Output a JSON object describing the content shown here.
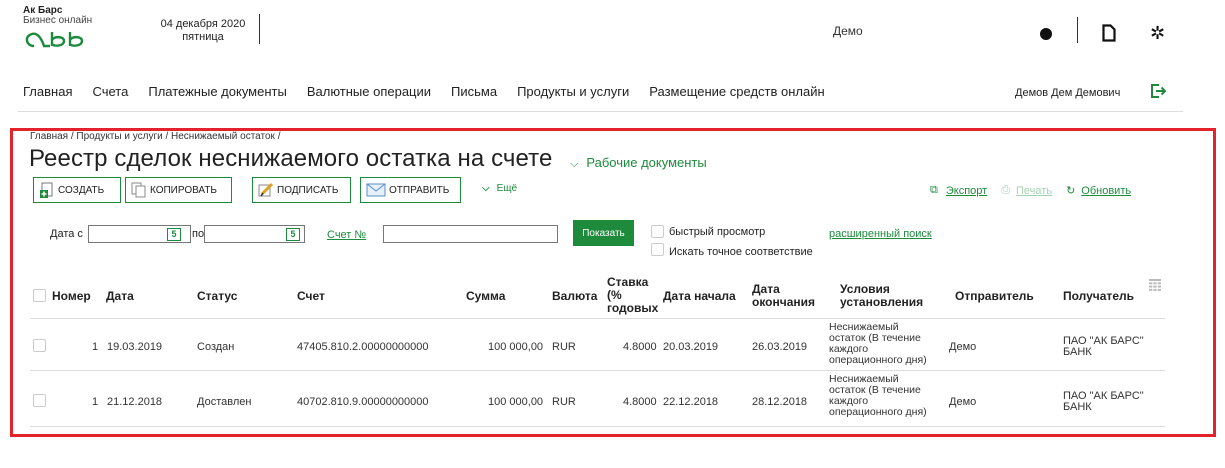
{
  "logo": {
    "line1": "Ак Барс",
    "line2": "Бизнес онлайн"
  },
  "header": {
    "date": "04 декабря 2020",
    "weekday": "пятница",
    "mode": "Демо"
  },
  "nav": {
    "items": [
      "Главная",
      "Счета",
      "Платежные документы",
      "Валютные операции",
      "Письма",
      "Продукты и услуги",
      "Размещение средств онлайн"
    ],
    "user": "Демов Дем Демович"
  },
  "breadcrumb": "Главная  /  Продукты и услуги  /  Неснижаемый остаток  /",
  "page_title": "Реестр сделок неснижаемого остатка на счете",
  "work_docs": "Рабочие документы",
  "toolbar": {
    "create": "СОЗДАТЬ",
    "copy": "КОПИРОВАТЬ",
    "sign": "ПОДПИСАТЬ",
    "send": "ОТПРАВИТЬ",
    "more": "Ещё",
    "export": "Экспорт",
    "print": "Печать",
    "refresh": "Обновить"
  },
  "filters": {
    "date_from_label": "Дата с",
    "date_to_label": "по",
    "account_label": "Счет №",
    "show": "Показать",
    "quick_view": "быстрый просмотр",
    "exact_match": "Искать точное соответствие",
    "advanced": "расширенный поиск"
  },
  "table": {
    "headers": {
      "number": "Номер",
      "date": "Дата",
      "status": "Статус",
      "account": "Счет",
      "amount": "Сумма",
      "currency": "Валюта",
      "rate": [
        "Ставка",
        "(%",
        "годовых"
      ],
      "start": "Дата начала",
      "end": [
        "Дата",
        "окончания"
      ],
      "terms": [
        "Условия",
        "установления"
      ],
      "sender": "Отправитель",
      "recipient": "Получатель"
    },
    "rows": [
      {
        "number": "1",
        "date": "19.03.2019",
        "status": "Создан",
        "account": "47405.810.2.00000000000",
        "amount": "100 000,00",
        "currency": "RUR",
        "rate": "4.8000",
        "start": "20.03.2019",
        "end": "26.03.2019",
        "terms": [
          "Неснижаемый",
          "остаток (В течение",
          "каждого",
          "операционного дня)"
        ],
        "sender": "Демо",
        "recipient": [
          "ПАО \"АК БАРС\"",
          "БАНК"
        ]
      },
      {
        "number": "1",
        "date": "21.12.2018",
        "status": "Доставлен",
        "account": "40702.810.9.00000000000",
        "amount": "100 000,00",
        "currency": "RUR",
        "rate": "4.8000",
        "start": "22.12.2018",
        "end": "28.12.2018",
        "terms": [
          "Неснижаемый",
          "остаток (В течение",
          "каждого",
          "операционного дня)"
        ],
        "sender": "Демо",
        "recipient": [
          "ПАО \"АК БАРС\"",
          "БАНК"
        ]
      }
    ]
  },
  "colors": {
    "accent": "#1d8a3c",
    "frame": "#e3232a"
  }
}
